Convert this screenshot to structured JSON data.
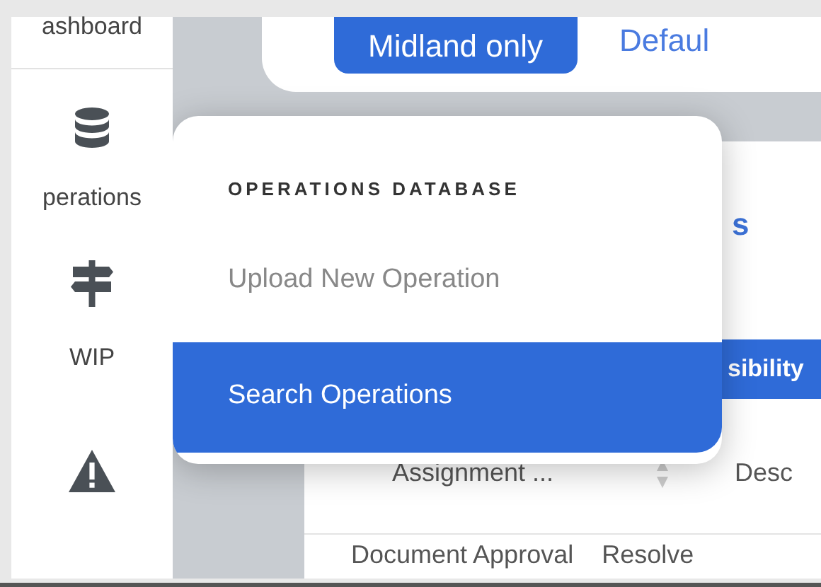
{
  "sidebar": {
    "items": [
      {
        "label": "ashboard"
      },
      {
        "label": "perations"
      },
      {
        "label": "WIP"
      }
    ]
  },
  "filter_bar": {
    "button": "Midland only",
    "link": "Defaul"
  },
  "content": {
    "heading": "s",
    "tab": "sibility",
    "columns": [
      "Assignment ...",
      "Desc"
    ],
    "rows": [
      [
        "Document Approval",
        "Resolve"
      ]
    ]
  },
  "menu": {
    "title": "OPERATIONS DATABASE",
    "items": [
      {
        "label": "Upload New Operation",
        "selected": false
      },
      {
        "label": "Search Operations",
        "selected": true
      }
    ]
  }
}
